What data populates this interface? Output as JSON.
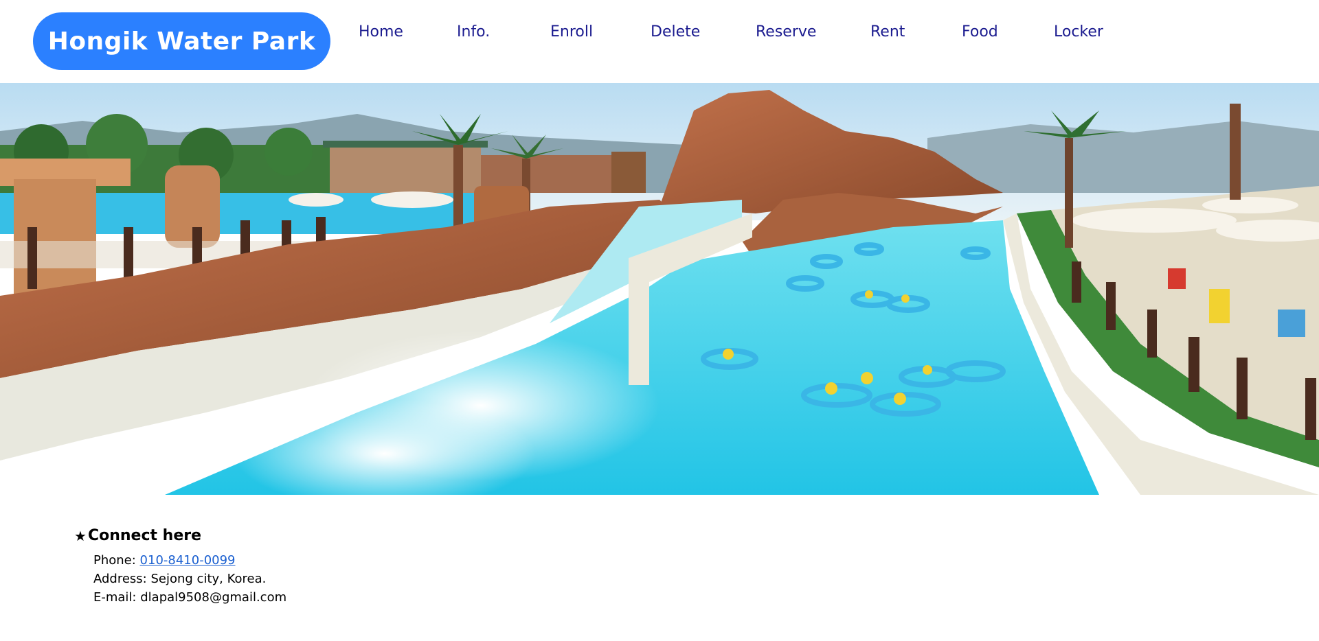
{
  "brand": {
    "title": "Hongik Water Park",
    "color": "#2b80ff"
  },
  "nav": {
    "items": [
      {
        "label": "Home"
      },
      {
        "label": "Info."
      },
      {
        "label": "Enroll"
      },
      {
        "label": "Delete"
      },
      {
        "label": "Reserve"
      },
      {
        "label": "Rent"
      },
      {
        "label": "Food"
      },
      {
        "label": "Locker"
      }
    ]
  },
  "hero": {
    "alt_icon": "water-park-photo"
  },
  "contact": {
    "title": "Connect here",
    "star_icon": "★",
    "phone_label": "Phone: ",
    "phone_value": "010-8410-0099",
    "address_label": "Address: ",
    "address_value": "Sejong city, Korea.",
    "email_label": "E-mail: ",
    "email_value": "dlapal9508@gmail.com"
  },
  "colors": {
    "nav_text": "#1b1b8f",
    "link": "#1a5fd0"
  }
}
